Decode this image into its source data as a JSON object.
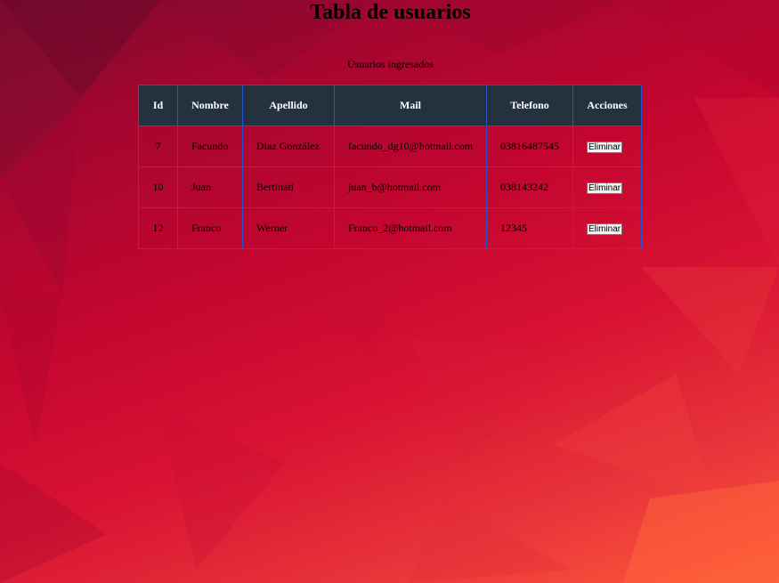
{
  "page": {
    "title": "Tabla de usuarios",
    "subtitle": "Usuarios ingresados"
  },
  "table": {
    "headers": [
      "Id",
      "Nombre",
      "Apellido",
      "Mail",
      "Telefono",
      "Acciones"
    ],
    "rows": [
      {
        "id": "7",
        "nombre": "Facundo",
        "apellido": "Diaz González",
        "mail": "facundo_dg10@hotmail.com",
        "telefono": "03816487545",
        "action_label": "Eliminar"
      },
      {
        "id": "10",
        "nombre": "Juan",
        "apellido": "Bertinati",
        "mail": "juan_b@hotmail.com",
        "telefono": "038143242",
        "action_label": "Eliminar"
      },
      {
        "id": "12",
        "nombre": "Franco",
        "apellido": "Werner",
        "mail": "Franco_2@hotmail.com",
        "telefono": "12345",
        "action_label": "Eliminar"
      }
    ]
  },
  "colors": {
    "header_bg": "#243240",
    "border": "#2255cc",
    "background_start": "#7a0a2e",
    "background_end": "#ff5a3a"
  }
}
